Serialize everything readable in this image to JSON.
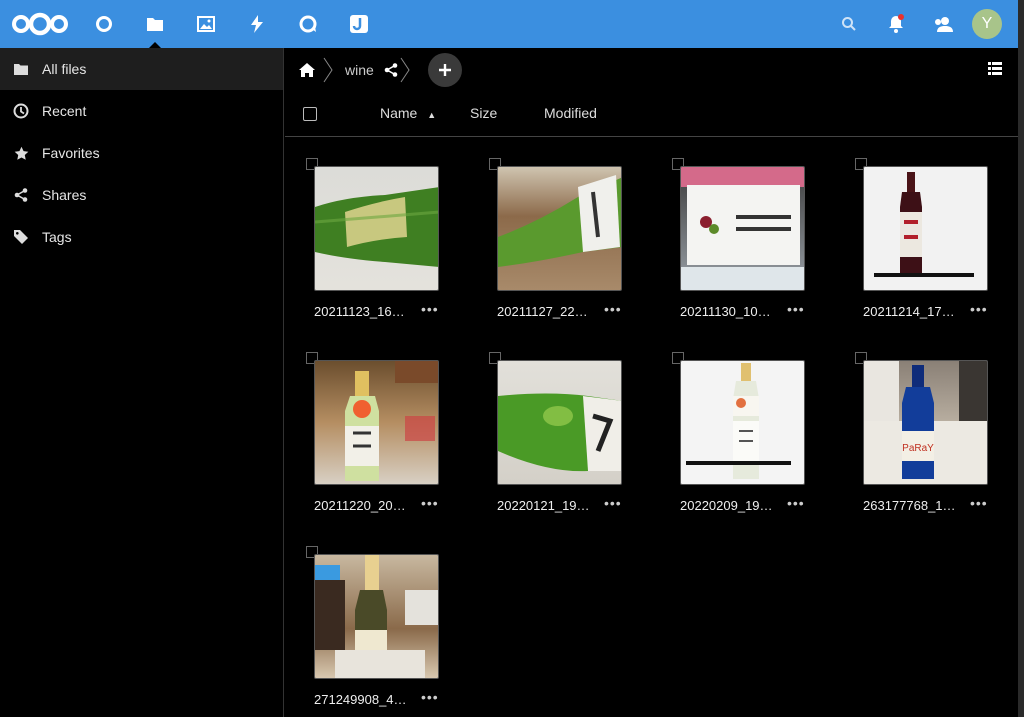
{
  "topbar": {
    "apps": [
      {
        "name": "dashboard-icon"
      },
      {
        "name": "files-icon",
        "active": true
      },
      {
        "name": "photos-icon"
      },
      {
        "name": "activity-icon"
      },
      {
        "name": "talk-icon"
      },
      {
        "name": "joplin-icon"
      }
    ],
    "avatar_letter": "Y",
    "accent": "#3b8fe0"
  },
  "sidebar": {
    "items": [
      {
        "label": "All files",
        "icon": "folder-icon"
      },
      {
        "label": "Recent",
        "icon": "clock-icon"
      },
      {
        "label": "Favorites",
        "icon": "star-icon"
      },
      {
        "label": "Shares",
        "icon": "share-icon"
      },
      {
        "label": "Tags",
        "icon": "tag-icon"
      }
    ]
  },
  "breadcrumb": {
    "folder": "wine"
  },
  "columns": {
    "name": "Name",
    "size": "Size",
    "modified": "Modified"
  },
  "files": [
    {
      "name": "20211123_16…",
      "more": "•••"
    },
    {
      "name": "20211127_22…",
      "more": "•••"
    },
    {
      "name": "20211130_10…",
      "more": "•••"
    },
    {
      "name": "20211214_17…",
      "more": "•••"
    },
    {
      "name": "20211220_20…",
      "more": "•••"
    },
    {
      "name": "20220121_19…",
      "more": "•••"
    },
    {
      "name": "20220209_19…",
      "more": "•••"
    },
    {
      "name": "263177768_1…",
      "more": "•••"
    },
    {
      "name": "271249908_4…",
      "more": "•••"
    }
  ]
}
